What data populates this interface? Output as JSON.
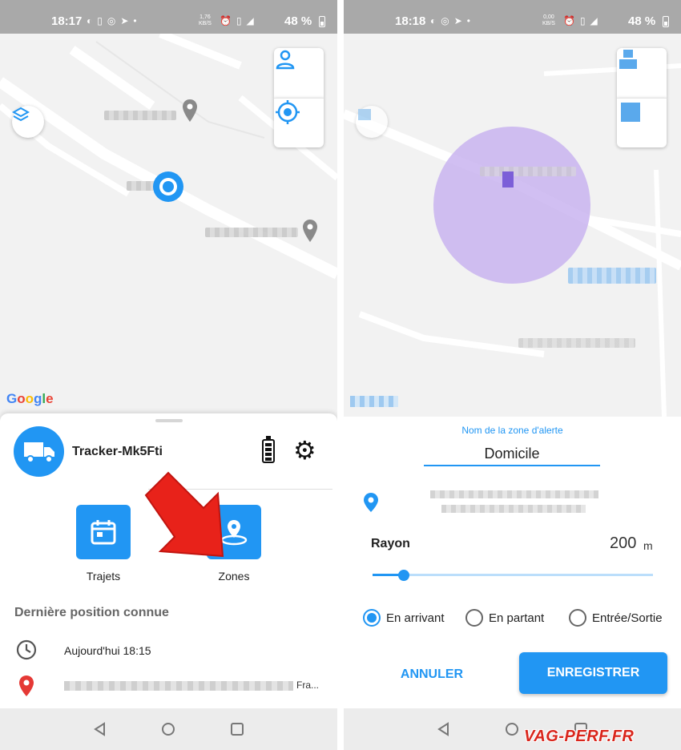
{
  "left": {
    "status": {
      "time": "18:17",
      "net_top": "1,76",
      "net_bottom": "KB/S",
      "battery": "48 %"
    },
    "map": {
      "logo": [
        "G",
        "o",
        "o",
        "g",
        "l",
        "e"
      ],
      "logo_colors": [
        "#4285f4",
        "#ea4335",
        "#fbbc05",
        "#4285f4",
        "#34a853",
        "#ea4335"
      ]
    },
    "sheet": {
      "device_name": "Tracker-Mk5Fti",
      "actions": [
        {
          "label": "Trajets",
          "icon": "calendar-icon"
        },
        {
          "label": "Zones",
          "icon": "zone-pin-icon"
        }
      ],
      "section_title": "Dernière position connue",
      "time_row": "Aujourd'hui 18:15",
      "address_end": "Fra..."
    }
  },
  "right": {
    "status": {
      "time": "18:18",
      "net_top": "0,00",
      "net_bottom": "KB/S",
      "battery": "48 %"
    },
    "form": {
      "zone_label": "Nom de la zone d'alerte",
      "zone_name": "Domicile",
      "radius_label": "Rayon",
      "radius_value": "200",
      "radius_unit": "m",
      "radius_fraction": 0.11,
      "options": [
        {
          "label": "En arrivant",
          "selected": true
        },
        {
          "label": "En partant",
          "selected": false
        },
        {
          "label": "Entrée/Sortie",
          "selected": false
        }
      ],
      "cancel": "ANNULER",
      "save": "ENREGISTRER"
    }
  },
  "colors": {
    "accent": "#2196f3",
    "arrow": "#e8221a",
    "zone_circle": "#c9b4f0"
  },
  "watermark": "VAG-PERF.FR"
}
